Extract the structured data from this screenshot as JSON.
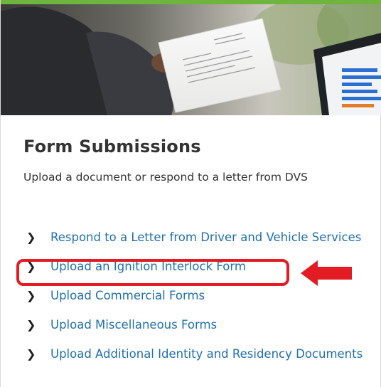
{
  "hero": {
    "image": "person-holding-letter-with-laptop-chart"
  },
  "section": {
    "title": "Form Submissions",
    "subtitle": "Upload a document or respond to a letter from DVS"
  },
  "links": [
    {
      "label": "Respond to a Letter from Driver and Vehicle Services",
      "icon": "chevron-right-icon",
      "highlighted": false
    },
    {
      "label": "Upload an Ignition Interlock Form",
      "icon": "chevron-right-icon",
      "highlighted": true
    },
    {
      "label": "Upload Commercial Forms",
      "icon": "chevron-right-icon",
      "highlighted": false
    },
    {
      "label": "Upload Miscellaneous Forms",
      "icon": "chevron-right-icon",
      "highlighted": false
    },
    {
      "label": "Upload Additional Identity and Residency Documents",
      "icon": "chevron-right-icon",
      "highlighted": false
    }
  ],
  "colors": {
    "accent_stripe": "#6fb43f",
    "link": "#1f6fb2",
    "title": "#333333",
    "annotation": "#e31b23"
  }
}
